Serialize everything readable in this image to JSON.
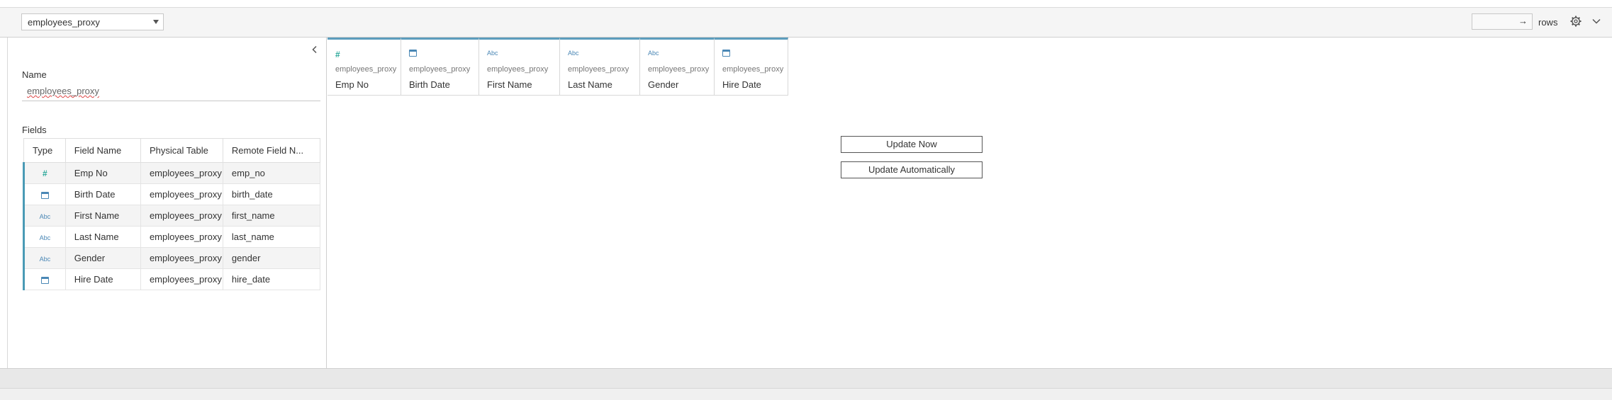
{
  "toolbar": {
    "table_select": "employees_proxy",
    "rows_value": "",
    "rows_arrow": "→",
    "rows_label": "rows"
  },
  "panel": {
    "name_label": "Name",
    "name_value": "employees_proxy",
    "fields_label": "Fields"
  },
  "fields": {
    "headers": [
      "Type",
      "Field Name",
      "Physical Table",
      "Remote Field N..."
    ],
    "rows": [
      {
        "type": "number",
        "type_glyph": "#",
        "field_name": "Emp No",
        "physical_table": "employees_proxy",
        "remote_field": "emp_no"
      },
      {
        "type": "date",
        "type_glyph": "",
        "field_name": "Birth Date",
        "physical_table": "employees_proxy",
        "remote_field": "birth_date"
      },
      {
        "type": "string",
        "type_glyph": "Abc",
        "field_name": "First Name",
        "physical_table": "employees_proxy",
        "remote_field": "first_name"
      },
      {
        "type": "string",
        "type_glyph": "Abc",
        "field_name": "Last Name",
        "physical_table": "employees_proxy",
        "remote_field": "last_name"
      },
      {
        "type": "string",
        "type_glyph": "Abc",
        "field_name": "Gender",
        "physical_table": "employees_proxy",
        "remote_field": "gender"
      },
      {
        "type": "date",
        "type_glyph": "",
        "field_name": "Hire Date",
        "physical_table": "employees_proxy",
        "remote_field": "hire_date"
      }
    ]
  },
  "grid": {
    "columns": [
      {
        "type": "number",
        "type_glyph": "#",
        "source": "employees_proxy",
        "field_name": "Emp No"
      },
      {
        "type": "date",
        "type_glyph": "",
        "source": "employees_proxy",
        "field_name": "Birth Date"
      },
      {
        "type": "string",
        "type_glyph": "Abc",
        "source": "employees_proxy",
        "field_name": "First Name"
      },
      {
        "type": "string",
        "type_glyph": "Abc",
        "source": "employees_proxy",
        "field_name": "Last Name"
      },
      {
        "type": "string",
        "type_glyph": "Abc",
        "source": "employees_proxy",
        "field_name": "Gender"
      },
      {
        "type": "date",
        "type_glyph": "",
        "source": "employees_proxy",
        "field_name": "Hire Date"
      }
    ]
  },
  "actions": {
    "update_now": "Update Now",
    "update_auto": "Update Automatically"
  },
  "icons": {
    "collapse": "chevron-left-icon",
    "gear": "gear-icon",
    "toolbar_menu": "chevron-down-icon",
    "number_type": "number-type-icon",
    "string_type": "string-type-icon",
    "date_type": "calendar-icon"
  },
  "colors": {
    "accent": "#4a9ab5",
    "grid_top": "#5c9dbd",
    "number_icon": "#2aa89a",
    "string_icon": "#4a87b5"
  }
}
